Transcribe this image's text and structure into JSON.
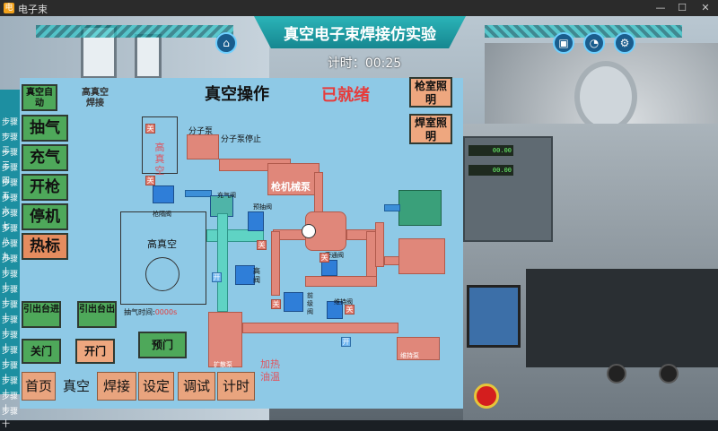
{
  "window": {
    "title": "电子束",
    "min": "—",
    "max": "☐",
    "close": "✕"
  },
  "header": {
    "title": "真空电子束焊接仿实验",
    "timer_label": "计时：",
    "timer_value": "00:25"
  },
  "top_icons": [
    "home-icon",
    "cube-icon",
    "pie-chart-icon",
    "gear-icon"
  ],
  "steps": [
    "步骤一",
    "步骤二",
    "步骤三",
    "步骤四",
    "步骤五",
    "步骤六",
    "步骤七",
    "步骤八",
    "步骤九",
    "步骤十",
    "步骤十",
    "步骤十",
    "步骤十",
    "步骤十",
    "步骤十",
    "步骤十",
    "步骤十",
    "步骤十",
    "步骤十",
    "步骤十"
  ],
  "panel": {
    "title": "真空操作",
    "status": "已就绪",
    "left_buttons": [
      "真空自动",
      "高真空焊接",
      "抽气",
      "充气",
      "开枪",
      "停机",
      "热标"
    ],
    "lower_buttons": [
      "引出台进",
      "引出台出",
      "关门",
      "开门",
      "预门"
    ],
    "right_buttons": [
      "枪室照明",
      "焊室照明"
    ],
    "diagram": {
      "high_vac_small": "高真空",
      "high_vac_big": "高真空",
      "gun_valve": "枪隔阀",
      "fill_valve": "充气阀",
      "pre_pump_valve": "预抽阀",
      "high_valve": "高阀",
      "bypass_valve": "旁通阀",
      "front_stage_valve": "前级阀",
      "maintain_valve": "维持阀",
      "maintain_pump": "维持泵",
      "diffusion_pump": "扩散泵",
      "molecular_pump": "分子泵",
      "molecular_pump_stop": "分子泵停止",
      "gun_mech_pump": "枪机械泵",
      "heat_oil_temp": "加热油温",
      "pump_time_label": "抽气时间:",
      "pump_time_value": "0000s",
      "x_mark": "关",
      "open_mark": "开",
      "preset_small": "开"
    }
  },
  "nav": [
    "首页",
    "真空",
    "焊接",
    "设定",
    "调试",
    "计时"
  ],
  "colors": {
    "panel_bg": "#8ec9e6",
    "status_red": "#e63b3b",
    "button_green": "#4ea85a",
    "button_orange": "#e58c5f",
    "title_teal": "#1b9aa3"
  }
}
